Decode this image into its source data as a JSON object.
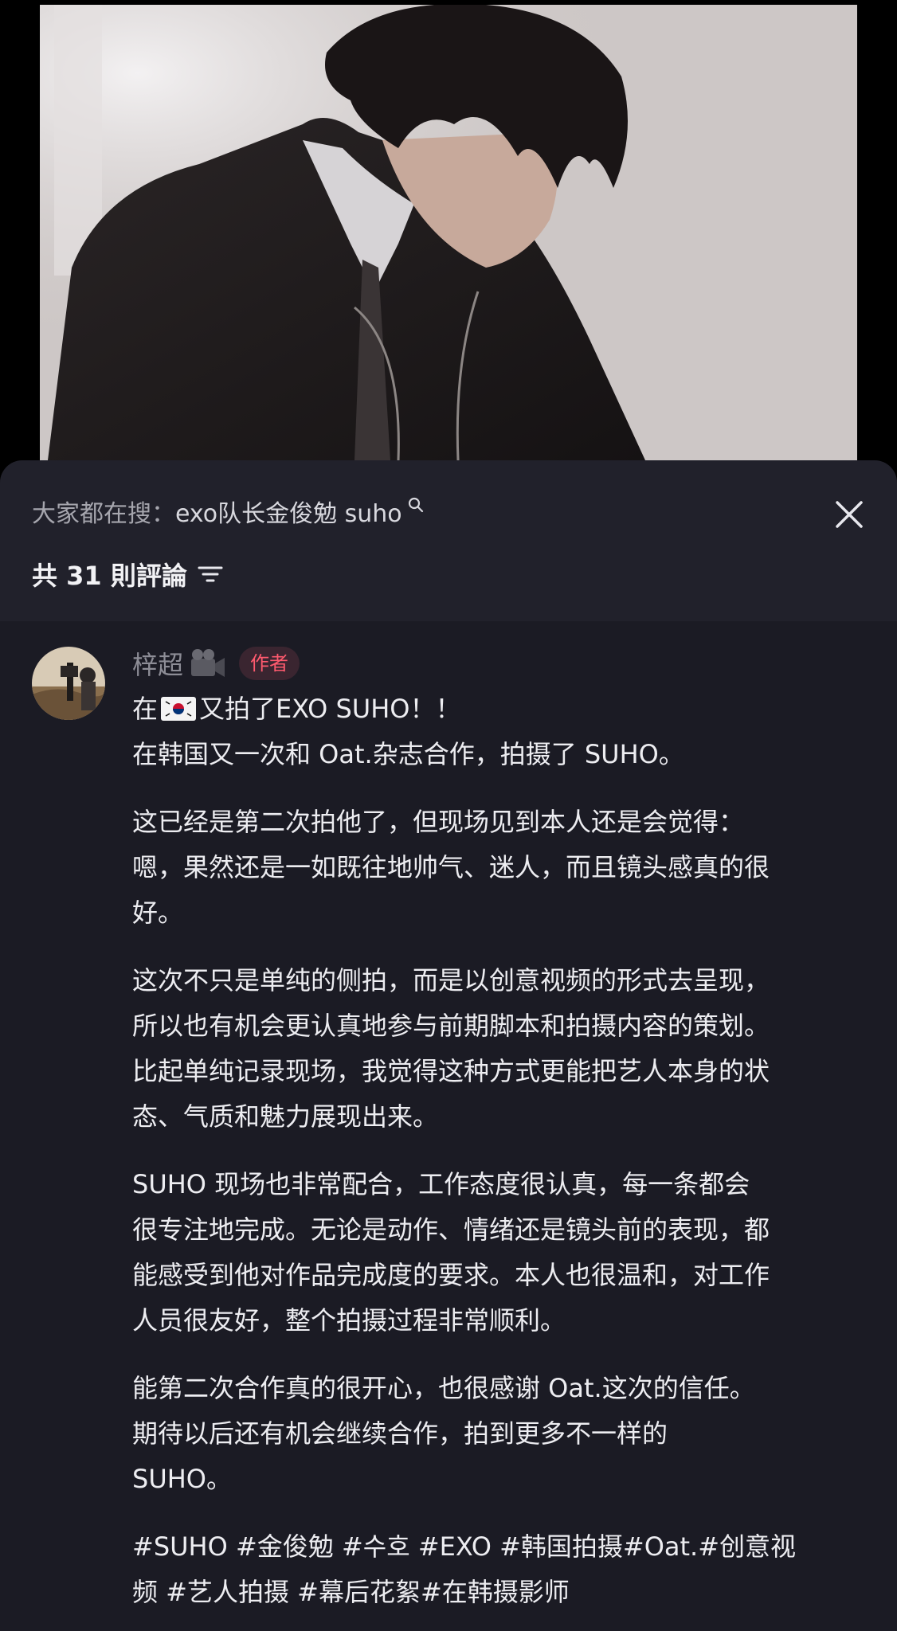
{
  "video": {
    "description_icon": "video-frame"
  },
  "search_hint": {
    "prefix": "大家都在搜：",
    "term": "exo队长金俊勉 suho"
  },
  "comments_header": {
    "count_label": "共 31 則評論"
  },
  "comment": {
    "author": "梓超",
    "badge": "作者",
    "paragraphs": [
      [
        "在",
        "又拍了EXO SUHO！！",
        "在韩国又一次和 Oat.杂志合作，拍摄了 SUHO。"
      ],
      [
        "这已经是第二次拍他了，但现场见到本人还是会觉得：",
        "嗯，果然还是一如既往地帅气、迷人，而且镜头感真的很",
        "好。"
      ],
      [
        "这次不只是单纯的侧拍，而是以创意视频的形式去呈现，",
        "所以也有机会更认真地参与前期脚本和拍摄内容的策划。",
        "比起单纯记录现场，我觉得这种方式更能把艺人本身的状",
        "态、气质和魅力展现出来。"
      ],
      [
        "SUHO 现场也非常配合，工作态度很认真，每一条都会",
        "很专注地完成。无论是动作、情绪还是镜头前的表现，都",
        "能感受到他对作品完成度的要求。本人也很温和，对工作",
        "人员很友好，整个拍摄过程非常顺利。"
      ],
      [
        "能第二次合作真的很开心，也很感谢 Oat.这次的信任。",
        "期待以后还有机会继续合作，拍到更多不一样的",
        "SUHO。"
      ],
      [
        "#SUHO #金俊勉 #수호 #EXO #韩国拍摄#Oat.#创意视",
        "频 #艺人拍摄 #幕后花絮#在韩摄影师"
      ]
    ]
  },
  "icons": [
    "close-icon",
    "search-icon",
    "sort-icon",
    "camera-icon",
    "korea-flag-icon"
  ]
}
